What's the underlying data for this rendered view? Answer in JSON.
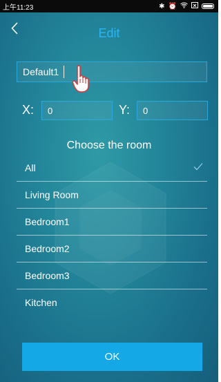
{
  "status_bar": {
    "time": "上午11:23",
    "icons": [
      "bluetooth-icon",
      "alarm-icon",
      "wifi-icon",
      "sim-icon",
      "battery-icon"
    ]
  },
  "header": {
    "title": "Edit",
    "back_icon": "chevron-left-icon"
  },
  "form": {
    "name_value": "Default1",
    "x_label": "X:",
    "x_value": "0",
    "y_label": "Y:",
    "y_value": "0"
  },
  "rooms": {
    "heading": "Choose the room",
    "items": [
      {
        "label": "All",
        "selected": true
      },
      {
        "label": "Living Room"
      },
      {
        "label": "Bedroom1"
      },
      {
        "label": "Bedroom2"
      },
      {
        "label": "Bedroom3"
      },
      {
        "label": "Kitchen"
      }
    ]
  },
  "ok_label": "OK",
  "colors": {
    "accent": "#2bb4f1",
    "button": "#14a8e6",
    "field_border": "#2aa8e0",
    "background": "#1f7f95"
  }
}
